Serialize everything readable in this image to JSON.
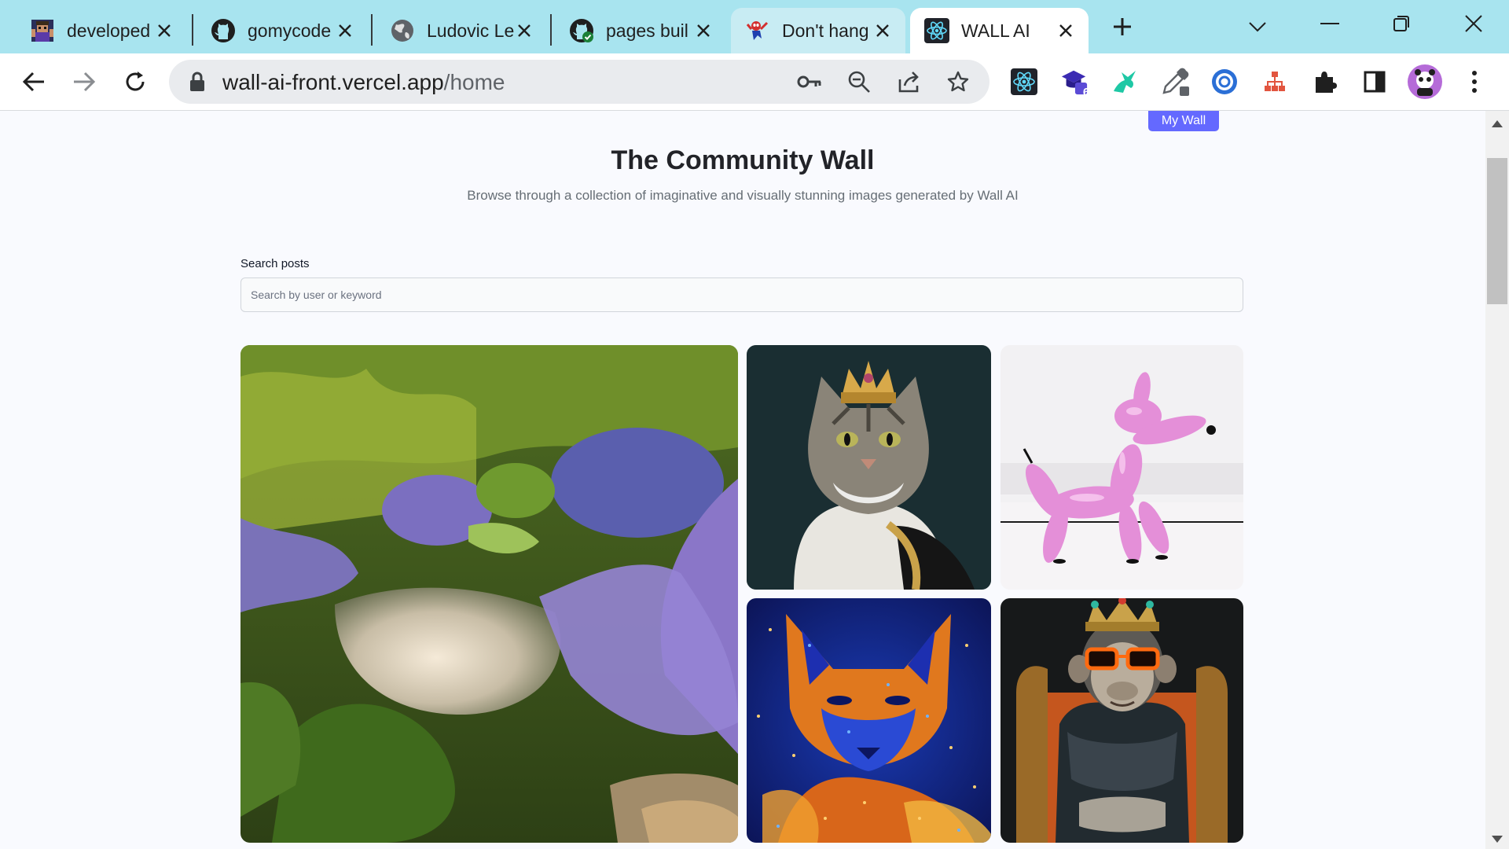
{
  "browser": {
    "tabs": [
      {
        "title": "developed",
        "icon": "pixel-avatar-icon"
      },
      {
        "title": "gomycode",
        "icon": "github-icon"
      },
      {
        "title": "Ludovic Le",
        "icon": "globe-icon"
      },
      {
        "title": "pages buil",
        "icon": "github-check-icon"
      },
      {
        "title": "Don't hang",
        "icon": "spiderman-icon"
      },
      {
        "title": "WALL AI",
        "icon": "react-icon"
      }
    ],
    "active_tab": 5,
    "url_host": "wall-ai-front.vercel.app",
    "url_path": "/home",
    "extension_badge": "6",
    "colors": {
      "tabstrip": "#a8e4ef",
      "toolbar": "#ffffff",
      "omnibox": "#e9ebee"
    }
  },
  "page": {
    "my_wall_label": "My Wall",
    "title": "The Community Wall",
    "subtitle": "Browse through a collection of imaginative and visually stunning images generated by Wall AI",
    "search": {
      "label": "Search posts",
      "placeholder": "Search by user or keyword",
      "value": ""
    },
    "gallery": [
      {
        "subject": "garden pond with lavender"
      },
      {
        "subject": "cat wearing a crown"
      },
      {
        "subject": "pink balloon dog"
      },
      {
        "subject": "fox made of blue and orange paint"
      },
      {
        "subject": "monkey king with sunglasses"
      }
    ],
    "colors": {
      "accent": "#6469ff",
      "title": "#222328",
      "subtitle": "#666e75"
    }
  }
}
